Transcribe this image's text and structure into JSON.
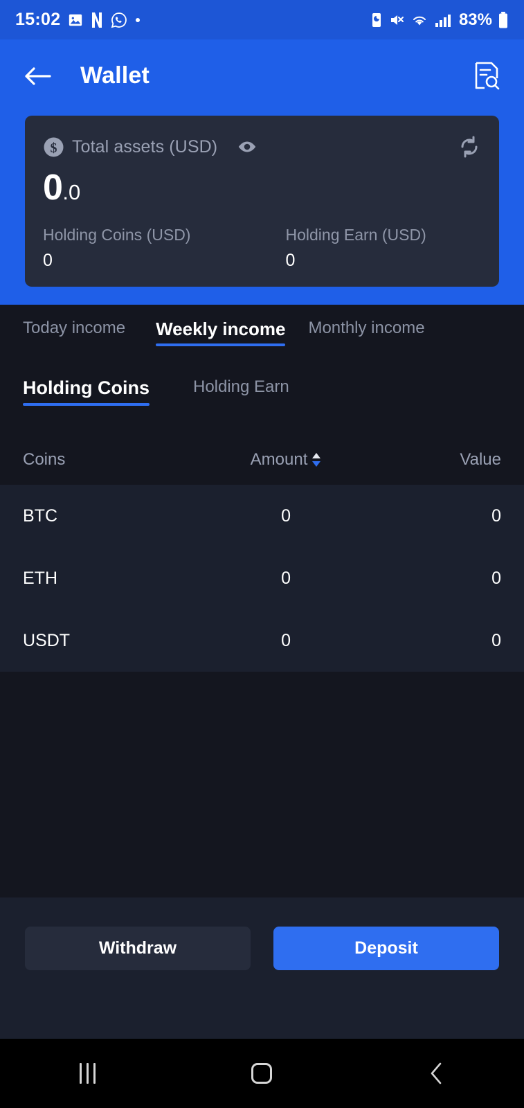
{
  "statusbar": {
    "time": "15:02",
    "battery_percent": "83%",
    "icons": [
      "gallery-icon",
      "netflix-icon",
      "whatsapp-icon",
      "dot-icon"
    ],
    "right_icons": [
      "battery-saver-icon",
      "mute-icon",
      "wifi-icon",
      "signal-icon"
    ]
  },
  "header": {
    "title": "Wallet",
    "back_icon": "back-arrow-icon",
    "history_icon": "document-search-icon"
  },
  "balance_card": {
    "dollar_icon": "dollar-circle-icon",
    "label": "Total assets (USD)",
    "eye_icon": "eye-icon",
    "refresh_icon": "refresh-icon",
    "amount_integer": "0",
    "amount_decimal": ".0",
    "holdings": [
      {
        "label": "Holding Coins (USD)",
        "value": "0"
      },
      {
        "label": "Holding Earn (USD)",
        "value": "0"
      }
    ]
  },
  "income_tabs": [
    {
      "label": "Today income",
      "active": false
    },
    {
      "label": "Weekly income",
      "active": true
    },
    {
      "label": "Monthly income",
      "active": false
    }
  ],
  "sub_tabs": [
    {
      "label": "Holding Coins",
      "active": true
    },
    {
      "label": "Holding Earn",
      "active": false
    }
  ],
  "table": {
    "columns": [
      "Coins",
      "Amount",
      "Value"
    ],
    "sort_column": "Amount",
    "sort_icon": "sort-arrows-icon",
    "rows": [
      {
        "coin": "BTC",
        "amount": "0",
        "value": "0"
      },
      {
        "coin": "ETH",
        "amount": "0",
        "value": "0"
      },
      {
        "coin": "USDT",
        "amount": "0",
        "value": "0"
      }
    ]
  },
  "actions": {
    "withdraw_label": "Withdraw",
    "deposit_label": "Deposit"
  },
  "navbar": {
    "recents_icon": "recents-icon",
    "home_icon": "home-icon",
    "back_icon": "nav-back-icon"
  },
  "colors": {
    "accent_blue": "#2f6ef0",
    "header_blue": "#1f5fe8",
    "status_blue": "#1d56d6",
    "card_bg": "#262c3c",
    "page_bg": "#14161f",
    "table_bg": "#1b202e"
  }
}
